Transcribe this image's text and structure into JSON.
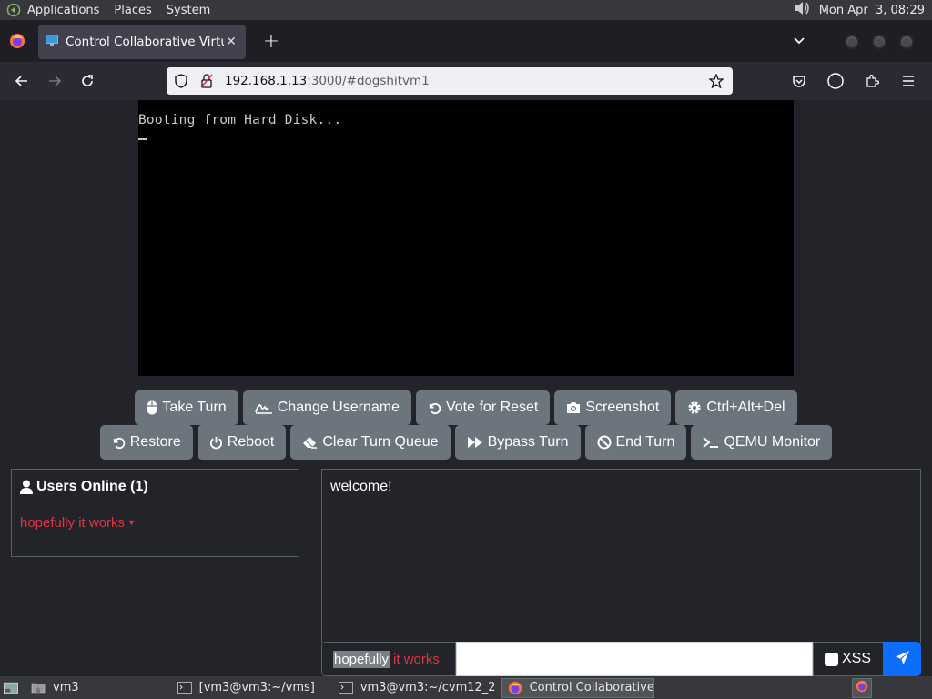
{
  "top_panel": {
    "menus": [
      "Applications",
      "Places",
      "System"
    ],
    "clock": "Mon Apr  3, 08:29"
  },
  "browser": {
    "tab_title": "Control Collaborative Virtual Machine",
    "url_host": "192.168.1.13",
    "url_rest": ":3000/#dogshitvm1"
  },
  "vm": {
    "console_line": "Booting from Hard Disk..."
  },
  "buttons_row1": [
    {
      "label": "Take Turn",
      "icon": "mouse-icon"
    },
    {
      "label": "Change Username",
      "icon": "signature-icon"
    },
    {
      "label": "Vote for Reset",
      "icon": "undo-icon"
    },
    {
      "label": "Screenshot",
      "icon": "camera-icon"
    },
    {
      "label": "Ctrl+Alt+Del",
      "icon": "gear-icon"
    }
  ],
  "buttons_row2": [
    {
      "label": "Restore",
      "icon": "undo-icon"
    },
    {
      "label": "Reboot",
      "icon": "power-icon"
    },
    {
      "label": "Clear Turn Queue",
      "icon": "eraser-icon"
    },
    {
      "label": "Bypass Turn",
      "icon": "forward-icon"
    },
    {
      "label": "End Turn",
      "icon": "ban-icon"
    },
    {
      "label": "QEMU Monitor",
      "icon": "terminal-icon"
    }
  ],
  "users": {
    "title": "Users Online (1)",
    "list": [
      "hopefully it works"
    ]
  },
  "chat": {
    "messages": [
      "welcome!"
    ],
    "username_first": "hopefully",
    "username_rest": "it works",
    "xss_label": "XSS"
  },
  "taskbar": {
    "items": [
      "vm3",
      "[vm3@vm3:~/vms]",
      "vm3@vm3:~/cvm12_2",
      "Control Collaborative..."
    ]
  },
  "colors": {
    "accent": "#0d6efd",
    "button": "#6c757d",
    "username": "#dc3545",
    "background": "#222429"
  }
}
